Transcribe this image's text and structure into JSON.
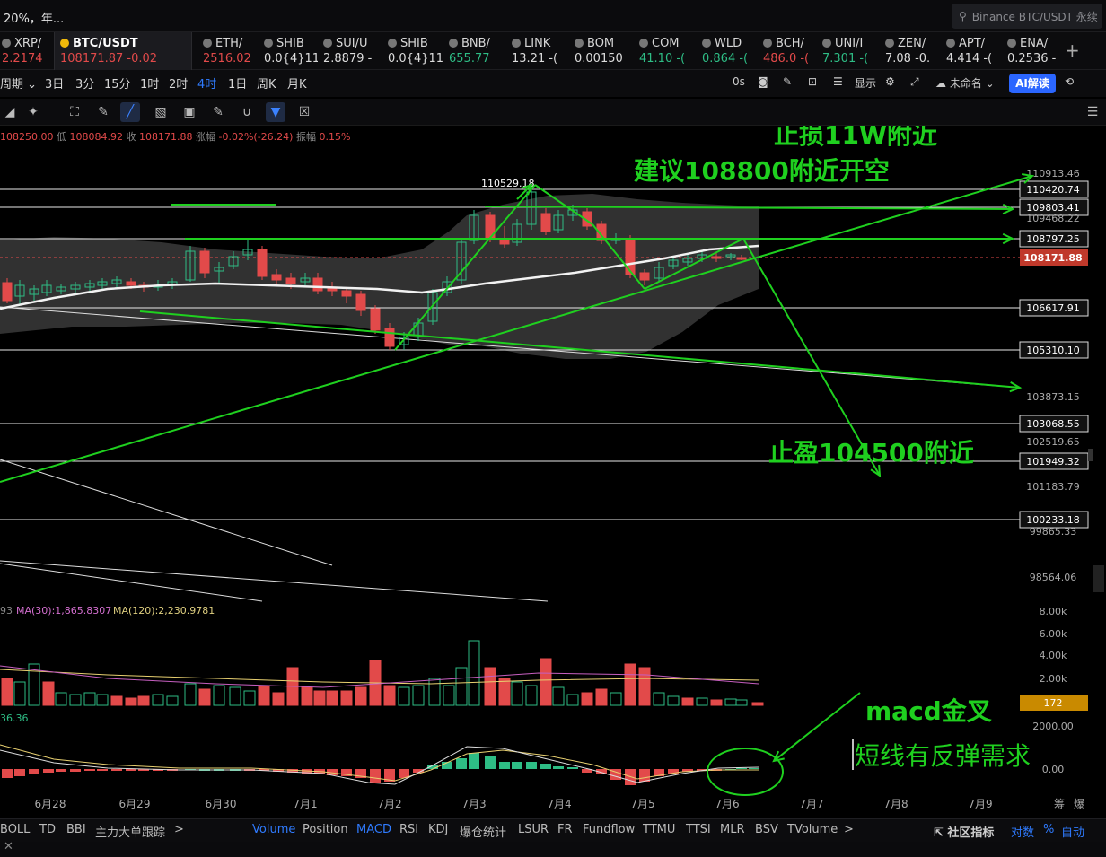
{
  "topbar": {
    "left_text": "20%，年...",
    "search_text": "Binance BTC/USDT 永续"
  },
  "tickers": [
    {
      "sym": "XRP/",
      "price": "2.2174",
      "change": "",
      "color": "#e24a4a"
    },
    {
      "sym": "BTC/USDT",
      "price": "108171.87",
      "change": "-0.02",
      "color": "#e24a4a",
      "active": true
    },
    {
      "sym": "ETH/",
      "price": "2516.02",
      "change": "",
      "color": "#e24a4a"
    },
    {
      "sym": "SHIB",
      "price": "0.0{4}11",
      "change": "",
      "color": "#dddddd"
    },
    {
      "sym": "SUI/U",
      "price": "2.8879",
      "change": "-",
      "color": "#dddddd"
    },
    {
      "sym": "SHIB",
      "price": "0.0{4}11",
      "change": "",
      "color": "#dddddd"
    },
    {
      "sym": "BNB/",
      "price": "655.77",
      "change": "",
      "color": "#2ebd85"
    },
    {
      "sym": "LINK",
      "price": "13.21",
      "change": "-(",
      "color": "#dddddd"
    },
    {
      "sym": "BOM",
      "price": "0.00150",
      "change": "",
      "color": "#dddddd"
    },
    {
      "sym": "COM",
      "price": "41.10",
      "change": "-(",
      "color": "#2ebd85"
    },
    {
      "sym": "WLD",
      "price": "0.864",
      "change": "-(",
      "color": "#2ebd85"
    },
    {
      "sym": "BCH/",
      "price": "486.0",
      "change": "-(",
      "color": "#e24a4a"
    },
    {
      "sym": "UNI/I",
      "price": "7.301",
      "change": "-(",
      "color": "#2ebd85"
    },
    {
      "sym": "ZEN/",
      "price": "7.08",
      "change": "-0.",
      "color": "#dddddd"
    },
    {
      "sym": "APT/",
      "price": "4.414",
      "change": "-(",
      "color": "#dddddd"
    },
    {
      "sym": "ENA/",
      "price": "0.2536",
      "change": "-",
      "color": "#dddddd"
    }
  ],
  "toolbar": {
    "timeframes": [
      "周期",
      "3日",
      "3分",
      "15分",
      "1时",
      "2时",
      "4时",
      "1日",
      "周K",
      "月K"
    ],
    "active_timeframe": "4时",
    "countdown": "0s",
    "display_label": "显示",
    "layout_label": "未命名",
    "ai_label": "AI解读"
  },
  "ohlc": {
    "open_prefix": "",
    "open": "108250.00",
    "low_label": "低",
    "low": "108084.92",
    "close_label": "收",
    "close": "108171.88",
    "change_label": "涨幅",
    "change": "-0.02%(-26.24)",
    "amp_label": "振幅",
    "amp": "0.15%"
  },
  "price_axis": {
    "labels": [
      "110913.46",
      "109468.22",
      "103873.15",
      "102519.65",
      "101183.79",
      "99865.33",
      "98564.06"
    ],
    "boxed": [
      "110420.74",
      "109803.41",
      "108797.25",
      "106617.91",
      "105310.10",
      "103068.55",
      "101949.32",
      "100233.18"
    ],
    "current": "108171.88"
  },
  "volume_axis": [
    "8.00k",
    "6.00k",
    "4.00k",
    "2.00k"
  ],
  "volume_current": "172",
  "macd_axis": [
    "2000.00",
    "0.00"
  ],
  "ma_label": "MA(30):1,865.8307",
  "ma_label_prefix": "93",
  "ma120_label": "MA(120):2,230.9781",
  "macd_value_label": "36.36",
  "high_label": "110529.18",
  "date_labels": [
    "6月28",
    "6月29",
    "6月30",
    "7月1",
    "7月2",
    "7月3",
    "7月4",
    "7月5",
    "7月6",
    "7月7",
    "7月8",
    "7月9"
  ],
  "axis_corner": [
    "筹",
    "爆"
  ],
  "annotations": {
    "stop_loss": "止损11W附近",
    "entry": "建议108800附近开空",
    "take_profit": "止盈104500附近",
    "macd_cross": "macd金叉",
    "rebound": "短线有反弹需求"
  },
  "indicators": [
    "BOLL",
    "TD",
    "BBI",
    "主力大单跟踪",
    ">",
    "Volume",
    "Position",
    "MACD",
    "RSI",
    "KDJ",
    "爆仓统计",
    "LSUR",
    "FR",
    "Fundflow",
    "TTMU",
    "TTSI",
    "MLR",
    "BSV",
    "TVolume",
    ">"
  ],
  "active_indicators": [
    "Volume",
    "MACD"
  ],
  "bottom_right": [
    "社区指标",
    "对数",
    "%",
    "自动"
  ],
  "colors": {
    "up": "#2ebd85",
    "down": "#e24a4a",
    "annotation": "#1fd01f",
    "accent": "#2f7bff"
  }
}
